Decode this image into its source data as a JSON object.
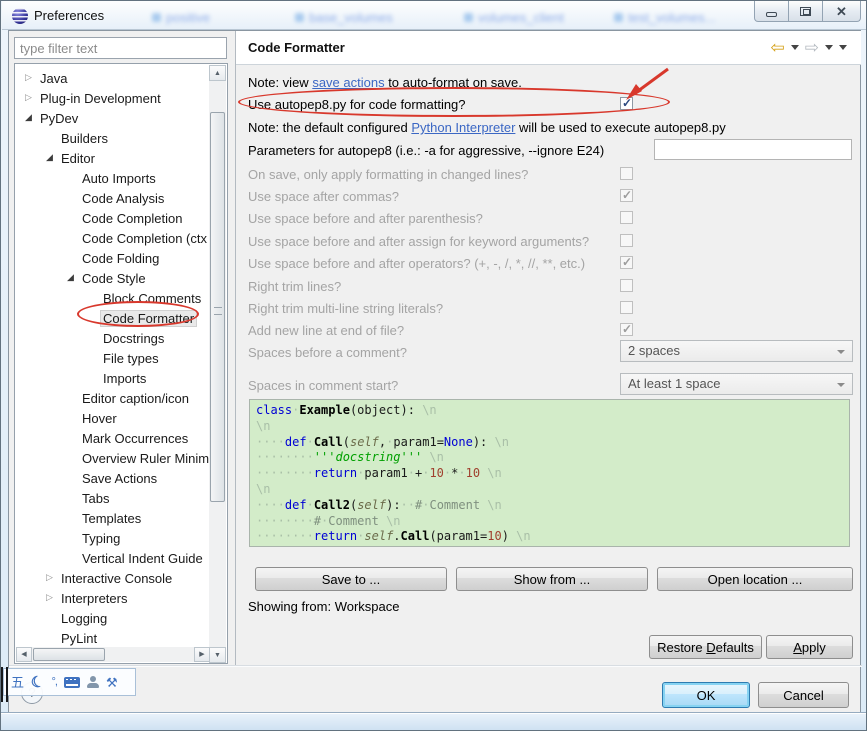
{
  "window": {
    "title": "Preferences",
    "controls": {
      "minimize": "minimize",
      "maximize": "maximize",
      "close": "close"
    },
    "ghost_tabs": [
      "positive",
      "base_volumes",
      "volumes_client",
      "test_volumes..."
    ]
  },
  "sidebar": {
    "filter_placeholder": "type filter text",
    "items": [
      {
        "label": "Java",
        "level": 0,
        "arrow": "collapsed"
      },
      {
        "label": "Plug-in Development",
        "level": 0,
        "arrow": "collapsed"
      },
      {
        "label": "PyDev",
        "level": 0,
        "arrow": "expanded"
      },
      {
        "label": "Builders",
        "level": 1,
        "arrow": "none"
      },
      {
        "label": "Editor",
        "level": 1,
        "arrow": "expanded"
      },
      {
        "label": "Auto Imports",
        "level": 2,
        "arrow": "none"
      },
      {
        "label": "Code Analysis",
        "level": 2,
        "arrow": "none"
      },
      {
        "label": "Code Completion",
        "level": 2,
        "arrow": "none"
      },
      {
        "label": "Code Completion (ctx i",
        "level": 2,
        "arrow": "none"
      },
      {
        "label": "Code Folding",
        "level": 2,
        "arrow": "none"
      },
      {
        "label": "Code Style",
        "level": 2,
        "arrow": "expanded"
      },
      {
        "label": "Block Comments",
        "level": 3,
        "arrow": "none"
      },
      {
        "label": "Code Formatter",
        "level": 3,
        "arrow": "none",
        "selected": true
      },
      {
        "label": "Docstrings",
        "level": 3,
        "arrow": "none"
      },
      {
        "label": "File types",
        "level": 3,
        "arrow": "none"
      },
      {
        "label": "Imports",
        "level": 3,
        "arrow": "none"
      },
      {
        "label": "Editor caption/icon",
        "level": 2,
        "arrow": "none"
      },
      {
        "label": "Hover",
        "level": 2,
        "arrow": "none"
      },
      {
        "label": "Mark Occurrences",
        "level": 2,
        "arrow": "none"
      },
      {
        "label": "Overview Ruler Minima",
        "level": 2,
        "arrow": "none"
      },
      {
        "label": "Save Actions",
        "level": 2,
        "arrow": "none"
      },
      {
        "label": "Tabs",
        "level": 2,
        "arrow": "none"
      },
      {
        "label": "Templates",
        "level": 2,
        "arrow": "none"
      },
      {
        "label": "Typing",
        "level": 2,
        "arrow": "none"
      },
      {
        "label": "Vertical Indent Guide",
        "level": 2,
        "arrow": "none"
      },
      {
        "label": "Interactive Console",
        "level": 1,
        "arrow": "collapsed"
      },
      {
        "label": "Interpreters",
        "level": 1,
        "arrow": "collapsed"
      },
      {
        "label": "Logging",
        "level": 1,
        "arrow": "none"
      },
      {
        "label": "PyLint",
        "level": 1,
        "arrow": "none"
      }
    ]
  },
  "header": {
    "title": "Code Formatter"
  },
  "content": {
    "note1": {
      "prefix": "Note: view ",
      "link": "save actions",
      "suffix": " to auto-format on save."
    },
    "autopep8_label": "Use autopep8.py for code formatting?",
    "autopep8_checked": true,
    "note2": {
      "prefix": "Note: the default configured ",
      "link": "Python Interpreter",
      "suffix": " will be used to execute autopep8.py"
    },
    "params_label": "Parameters for autopep8 (i.e.: -a for aggressive, --ignore E24)",
    "params_value": "",
    "options": [
      {
        "label": "On save, only apply formatting in changed lines?",
        "checked": false
      },
      {
        "label": "Use space after commas?",
        "checked": true
      },
      {
        "label": "Use space before and after parenthesis?",
        "checked": false
      },
      {
        "label": "Use space before and after assign for keyword arguments?",
        "checked": false
      },
      {
        "label": "Use space before and after operators? (+, -, /, *, //, **, etc.)",
        "checked": true
      },
      {
        "label": "Right trim lines?",
        "checked": false
      },
      {
        "label": "Right trim multi-line string literals?",
        "checked": false
      },
      {
        "label": "Add new line at end of file?",
        "checked": true
      }
    ],
    "selects": [
      {
        "label": "Spaces before a comment?",
        "value": "2 spaces"
      },
      {
        "label": "Spaces in comment start?",
        "value": "At least 1 space"
      }
    ],
    "code_lines": [
      [
        {
          "c": "kw",
          "t": "class"
        },
        {
          "c": "ws",
          "t": "·"
        },
        {
          "c": "name",
          "t": "Example"
        },
        {
          "c": "pl",
          "t": "(object):"
        },
        {
          "c": "ws",
          "t": " \\n"
        }
      ],
      [
        {
          "c": "ws",
          "t": "\\n"
        }
      ],
      [
        {
          "c": "ws",
          "t": "····"
        },
        {
          "c": "kw",
          "t": "def"
        },
        {
          "c": "ws",
          "t": "·"
        },
        {
          "c": "name",
          "t": "Call"
        },
        {
          "c": "pl",
          "t": "("
        },
        {
          "c": "self",
          "t": "self"
        },
        {
          "c": "pl",
          "t": ","
        },
        {
          "c": "ws",
          "t": "·"
        },
        {
          "c": "pl",
          "t": "param1="
        },
        {
          "c": "kw",
          "t": "None"
        },
        {
          "c": "pl",
          "t": "):"
        },
        {
          "c": "ws",
          "t": " \\n"
        }
      ],
      [
        {
          "c": "ws",
          "t": "········"
        },
        {
          "c": "str",
          "t": "'''docstring'''"
        },
        {
          "c": "ws",
          "t": " \\n"
        }
      ],
      [
        {
          "c": "ws",
          "t": "········"
        },
        {
          "c": "kw",
          "t": "return"
        },
        {
          "c": "ws",
          "t": "·"
        },
        {
          "c": "pl",
          "t": "param1"
        },
        {
          "c": "ws",
          "t": "·"
        },
        {
          "c": "pl",
          "t": "+"
        },
        {
          "c": "ws",
          "t": "·"
        },
        {
          "c": "num",
          "t": "10"
        },
        {
          "c": "ws",
          "t": "·"
        },
        {
          "c": "pl",
          "t": "*"
        },
        {
          "c": "ws",
          "t": "·"
        },
        {
          "c": "num",
          "t": "10"
        },
        {
          "c": "ws",
          "t": " \\n"
        }
      ],
      [
        {
          "c": "ws",
          "t": "\\n"
        }
      ],
      [
        {
          "c": "ws",
          "t": "····"
        },
        {
          "c": "kw",
          "t": "def"
        },
        {
          "c": "ws",
          "t": "·"
        },
        {
          "c": "name",
          "t": "Call2"
        },
        {
          "c": "pl",
          "t": "("
        },
        {
          "c": "self",
          "t": "self"
        },
        {
          "c": "pl",
          "t": "):"
        },
        {
          "c": "ws",
          "t": "··"
        },
        {
          "c": "com",
          "t": "#"
        },
        {
          "c": "ws",
          "t": "·"
        },
        {
          "c": "com",
          "t": "Comment"
        },
        {
          "c": "ws",
          "t": " \\n"
        }
      ],
      [
        {
          "c": "ws",
          "t": "········"
        },
        {
          "c": "com",
          "t": "#"
        },
        {
          "c": "ws",
          "t": "·"
        },
        {
          "c": "com",
          "t": "Comment"
        },
        {
          "c": "ws",
          "t": " \\n"
        }
      ],
      [
        {
          "c": "ws",
          "t": "········"
        },
        {
          "c": "kw",
          "t": "return"
        },
        {
          "c": "ws",
          "t": "·"
        },
        {
          "c": "self",
          "t": "self"
        },
        {
          "c": "pl",
          "t": "."
        },
        {
          "c": "name",
          "t": "Call"
        },
        {
          "c": "pl",
          "t": "(param1="
        },
        {
          "c": "num",
          "t": "10"
        },
        {
          "c": "pl",
          "t": ")"
        },
        {
          "c": "ws",
          "t": " \\n"
        }
      ]
    ],
    "preview_buttons": [
      "Save to ...",
      "Show from ...",
      "Open location ..."
    ],
    "showing_from": "Showing from: Workspace",
    "restore_defaults": {
      "prefix": "Restore ",
      "accel": "D",
      "suffix": "efaults"
    },
    "apply": {
      "accel": "A",
      "suffix": "pply"
    }
  },
  "footer": {
    "ok": "OK",
    "cancel": "Cancel",
    "help": "?"
  },
  "colors": {
    "annotation": "#d8382c",
    "code_background": "#d3ecc9",
    "link": "#3b67c4",
    "keyword": "#0000d4"
  }
}
